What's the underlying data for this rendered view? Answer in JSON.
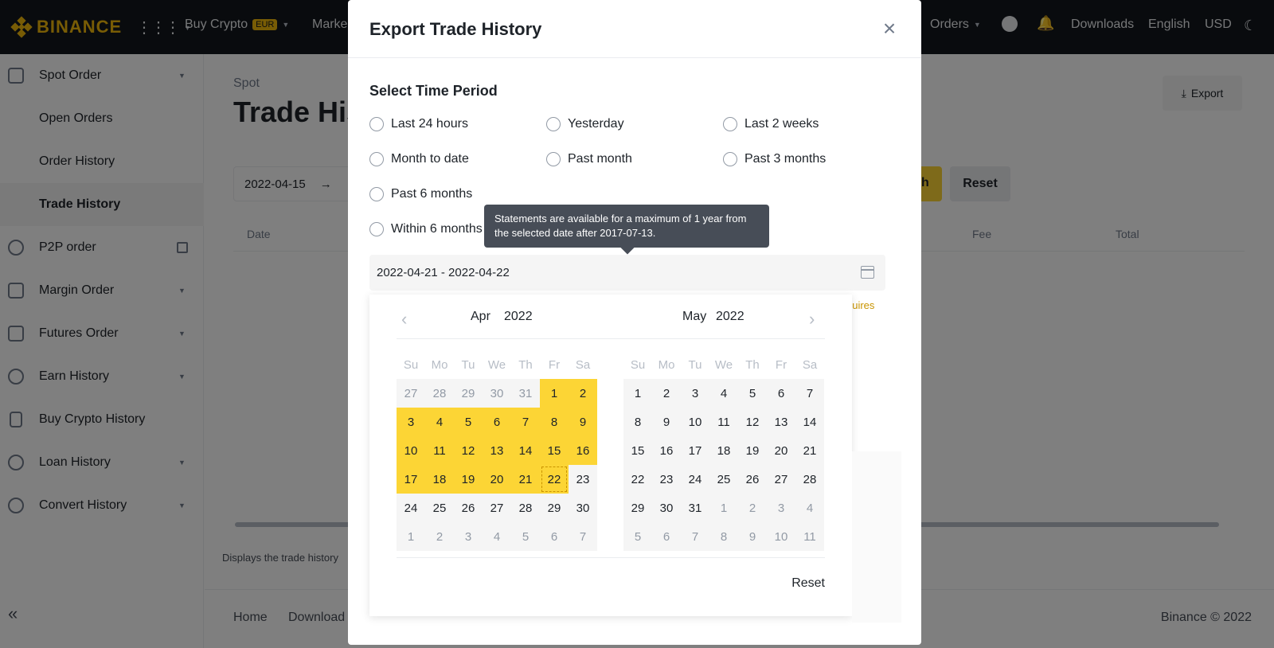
{
  "nav": {
    "brand": "BINANCE",
    "buy_crypto": "Buy Crypto",
    "currency_badge": "EUR",
    "markets": "Marke",
    "orders": "Orders",
    "downloads": "Downloads",
    "language": "English",
    "currency": "USD",
    "icons": [
      "apps-grid-icon",
      "account-icon",
      "bell-icon",
      "moon-icon"
    ]
  },
  "sidebar": {
    "items": [
      {
        "label": "Spot Order",
        "icon": "wallet-icon",
        "has_caret": true
      },
      {
        "label": "Open Orders"
      },
      {
        "label": "Order History"
      },
      {
        "label": "Trade History",
        "active": true
      },
      {
        "label": "P2P order",
        "icon": "people-icon",
        "external": true
      },
      {
        "label": "Margin Order",
        "icon": "margin-icon",
        "has_caret": true
      },
      {
        "label": "Futures Order",
        "icon": "futures-icon",
        "has_caret": true
      },
      {
        "label": "Earn History",
        "icon": "earn-icon",
        "has_caret": true
      },
      {
        "label": "Buy Crypto History",
        "icon": "document-icon"
      },
      {
        "label": "Loan History",
        "icon": "loan-icon",
        "has_caret": true
      },
      {
        "label": "Convert History",
        "icon": "convert-icon",
        "has_caret": true
      }
    ],
    "collapse": "«"
  },
  "main": {
    "breadcrumb": "Spot",
    "title": "Trade His",
    "export_label": "Export",
    "date_start": "2022-04-15",
    "arrow": "→",
    "search_label": "h",
    "reset_label": "Reset",
    "columns": [
      "Date",
      "Fee",
      "Total"
    ],
    "footnote": "Displays the trade history",
    "footer_links": [
      "Home",
      "Download"
    ],
    "copyright": "Binance © 2022"
  },
  "modal": {
    "title": "Export Trade History",
    "close": "×",
    "section_label": "Select Time Period",
    "options": [
      "Last 24 hours",
      "Yesterday",
      "Last 2 weeks",
      "Month to date",
      "Past month",
      "Past 3 months",
      "Past 6 months",
      "Within 6 months"
    ],
    "tooltip": "Statements are available for a maximum of 1 year from the selected date after 2017-07-13.",
    "range_value": "2022-04-21 - 2022-04-22",
    "expire_note": "quires",
    "calendar": {
      "weekdays": [
        "Su",
        "Mo",
        "Tu",
        "We",
        "Th",
        "Fr",
        "Sa"
      ],
      "left": {
        "month": "Apr",
        "year": "2022",
        "prev": "‹"
      },
      "right": {
        "month": "May",
        "year": "2022",
        "next": "›"
      },
      "reset": "Reset"
    }
  },
  "colors": {
    "brand": "#f0b90b",
    "selected": "#fcd535",
    "topbar": "#12161c"
  }
}
